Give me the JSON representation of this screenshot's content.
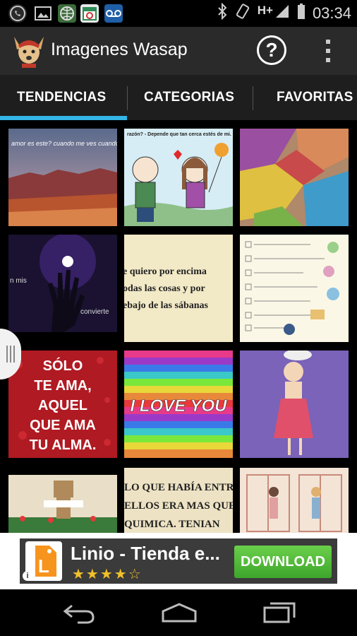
{
  "status_bar": {
    "network_type": "H+",
    "time": "03:34",
    "notification_icons": [
      "whatsapp-icon",
      "image-icon",
      "globe-icon",
      "calendar-icon",
      "voicemail-icon"
    ],
    "system_icons": [
      "bluetooth-icon",
      "rotation-icon",
      "signal-icon",
      "battery-icon"
    ]
  },
  "action_bar": {
    "title": "Imagenes Wasap",
    "help_icon": "question-icon",
    "overflow_icon": "overflow-menu-icon"
  },
  "tabs": [
    {
      "label": "TENDENCIAS",
      "selected": true
    },
    {
      "label": "CATEGORIAS",
      "selected": false
    },
    {
      "label": "FAVORITAS",
      "selected": false
    }
  ],
  "accent_color": "#33b5e5",
  "grid": {
    "items": [
      {
        "caption": "amor es este? cuando me ves cuando me alejo te acercas"
      },
      {
        "caption": "razón? - Depende que tan cerca estés de mi."
      },
      {
        "caption": ""
      },
      {
        "caption": "n mis",
        "caption2": "convierte"
      },
      {
        "lines": [
          "e quiero por encima",
          "odas las cosas y por",
          "ebajo de las sábanas"
        ]
      },
      {
        "caption": ""
      },
      {
        "lines": [
          "SÓLO",
          "TE AMA,",
          "AQUEL",
          "QUE AMA",
          "TU ALMA."
        ]
      },
      {
        "caption": "I LOVE YOU"
      },
      {
        "caption": ""
      },
      {
        "caption": ""
      },
      {
        "lines": [
          "LO QUE HABÍA ENTRE",
          "ELLOS ERA MAS QUE",
          "QUIMICA. TENIAN"
        ]
      },
      {
        "caption": ""
      }
    ]
  },
  "ad": {
    "title": "Linio - Tienda e...",
    "rating_stars": "★★★★☆",
    "download_label": "DOWNLOAD",
    "info_label": "i",
    "logo_letter": "L"
  },
  "nav_bar": {
    "buttons": [
      "back-icon",
      "home-icon",
      "recents-icon"
    ]
  }
}
